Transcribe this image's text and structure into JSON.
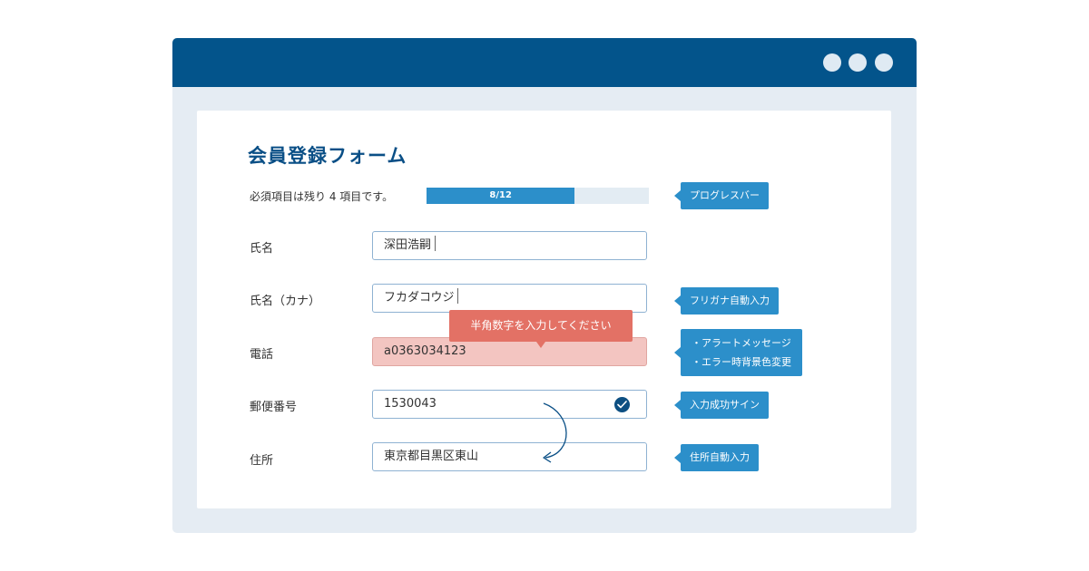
{
  "form": {
    "title": "会員登録フォーム",
    "remaining_text": "必須項目は残り 4 項目です。",
    "progress": {
      "label": "8/12",
      "current": 8,
      "total": 12
    }
  },
  "fields": {
    "name": {
      "label": "氏名",
      "value": "深田浩嗣"
    },
    "kana": {
      "label": "氏名（カナ）",
      "value": "フカダコウジ"
    },
    "phone": {
      "label": "電話",
      "value": "a0363034123",
      "error_message": "半角数字を入力してください"
    },
    "postal": {
      "label": "郵便番号",
      "value": "1530043"
    },
    "address": {
      "label": "住所",
      "value": "東京都目黒区東山"
    }
  },
  "callouts": {
    "progress": "プログレスバー",
    "furigana": "フリガナ自動入力",
    "alert_line1": "・アラートメッセージ",
    "alert_line2": "・エラー時背景色変更",
    "success": "入力成功サイン",
    "address_auto": "住所自動入力"
  },
  "icons": {
    "window_dots": "window-control-dots",
    "check": "check-circle-icon",
    "arrow": "curved-arrow-icon"
  },
  "colors": {
    "titlebar": "#03548b",
    "accent": "#2c8fca",
    "error_bg": "#f3c5c1",
    "error_tooltip": "#e37165",
    "heading": "#0a4f86"
  }
}
